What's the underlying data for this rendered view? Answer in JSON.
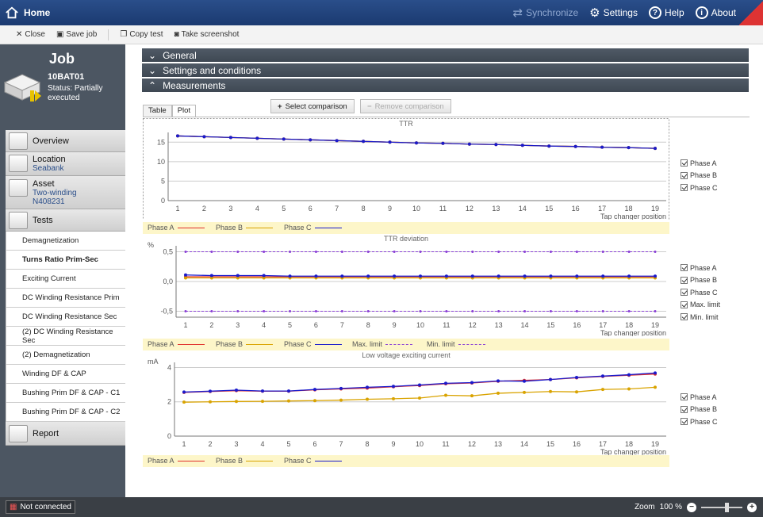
{
  "header": {
    "home": "Home",
    "synchronize": "Synchronize",
    "settings": "Settings",
    "help": "Help",
    "about": "About"
  },
  "toolbar": {
    "close": "Close",
    "save_job": "Save job",
    "copy_test": "Copy test",
    "take_screenshot": "Take screenshot"
  },
  "job": {
    "title": "Job",
    "id": "10BAT01",
    "status": "Status: Partially executed"
  },
  "nav": {
    "overview": "Overview",
    "location": "Location",
    "location_value": "Seabank",
    "asset": "Asset",
    "asset_type": "Two-winding",
    "asset_id": "N408231",
    "tests": "Tests",
    "report": "Report",
    "test_items": [
      "Demagnetization",
      "Turns Ratio Prim-Sec",
      "Exciting Current",
      "DC Winding Resistance Prim",
      "DC Winding Resistance Sec",
      "(2) DC Winding Resistance Sec",
      "(2) Demagnetization",
      "Winding DF & CAP",
      "Bushing Prim DF & CAP - C1",
      "Bushing Prim DF & CAP - C2"
    ],
    "active_test_index": 1
  },
  "sections": {
    "general": "General",
    "settings": "Settings and conditions",
    "measurements": "Measurements"
  },
  "tabs": {
    "table": "Table",
    "plot": "Plot"
  },
  "buttons": {
    "select_comparison": "Select comparison",
    "remove_comparison": "Remove comparison"
  },
  "status": {
    "connection": "Not connected",
    "zoom_label": "Zoom",
    "zoom_value": "100 %"
  },
  "colors": {
    "phase_a": "#e0302c",
    "phase_b": "#d9a300",
    "phase_c": "#1a1acc",
    "limit": "#8a3fd6"
  },
  "chart_data": [
    {
      "type": "line",
      "title": "TTR",
      "xlabel": "Tap changer position",
      "ylabel": "",
      "x": [
        1,
        2,
        3,
        4,
        5,
        6,
        7,
        8,
        9,
        10,
        11,
        12,
        13,
        14,
        15,
        16,
        17,
        18,
        19
      ],
      "ylim": [
        0,
        17.5
      ],
      "yticks": [
        0,
        5,
        10,
        15
      ],
      "series": [
        {
          "name": "Phase A",
          "values": [
            16.6,
            16.4,
            16.2,
            16.0,
            15.8,
            15.6,
            15.4,
            15.2,
            15.0,
            14.8,
            14.7,
            14.5,
            14.4,
            14.2,
            14.0,
            13.9,
            13.7,
            13.6,
            13.4
          ]
        },
        {
          "name": "Phase B",
          "values": [
            16.6,
            16.4,
            16.2,
            16.0,
            15.8,
            15.6,
            15.4,
            15.2,
            15.0,
            14.8,
            14.7,
            14.5,
            14.4,
            14.2,
            14.0,
            13.9,
            13.7,
            13.6,
            13.4
          ]
        },
        {
          "name": "Phase C",
          "values": [
            16.6,
            16.4,
            16.2,
            16.0,
            15.8,
            15.6,
            15.4,
            15.2,
            15.0,
            14.8,
            14.7,
            14.5,
            14.4,
            14.2,
            14.0,
            13.9,
            13.7,
            13.6,
            13.4
          ]
        }
      ],
      "legend_checks": [
        "Phase A",
        "Phase B",
        "Phase C"
      ]
    },
    {
      "type": "line",
      "title": "TTR deviation",
      "xlabel": "Tap changer position",
      "ylabel": "%",
      "x": [
        1,
        2,
        3,
        4,
        5,
        6,
        7,
        8,
        9,
        10,
        11,
        12,
        13,
        14,
        15,
        16,
        17,
        18,
        19
      ],
      "ylim": [
        -0.6,
        0.6
      ],
      "yticks": [
        -0.5,
        0.0,
        0.5
      ],
      "ytick_labels": [
        "-0,5",
        "0,0",
        "0,5"
      ],
      "series": [
        {
          "name": "Phase A",
          "values": [
            0.08,
            0.08,
            0.08,
            0.08,
            0.08,
            0.08,
            0.08,
            0.08,
            0.08,
            0.08,
            0.08,
            0.08,
            0.08,
            0.08,
            0.08,
            0.08,
            0.08,
            0.08,
            0.08
          ]
        },
        {
          "name": "Phase B",
          "values": [
            0.06,
            0.06,
            0.06,
            0.06,
            0.06,
            0.06,
            0.06,
            0.06,
            0.06,
            0.06,
            0.06,
            0.06,
            0.06,
            0.06,
            0.06,
            0.06,
            0.06,
            0.06,
            0.06
          ]
        },
        {
          "name": "Phase C",
          "values": [
            0.11,
            0.1,
            0.1,
            0.1,
            0.09,
            0.09,
            0.09,
            0.09,
            0.09,
            0.09,
            0.09,
            0.09,
            0.09,
            0.09,
            0.09,
            0.09,
            0.09,
            0.09,
            0.09
          ]
        },
        {
          "name": "Max. limit",
          "values": [
            0.5,
            0.5,
            0.5,
            0.5,
            0.5,
            0.5,
            0.5,
            0.5,
            0.5,
            0.5,
            0.5,
            0.5,
            0.5,
            0.5,
            0.5,
            0.5,
            0.5,
            0.5,
            0.5
          ]
        },
        {
          "name": "Min. limit",
          "values": [
            -0.5,
            -0.5,
            -0.5,
            -0.5,
            -0.5,
            -0.5,
            -0.5,
            -0.5,
            -0.5,
            -0.5,
            -0.5,
            -0.5,
            -0.5,
            -0.5,
            -0.5,
            -0.5,
            -0.5,
            -0.5,
            -0.5
          ]
        }
      ],
      "legend_checks": [
        "Phase A",
        "Phase B",
        "Phase C",
        "Max. limit",
        "Min. limit"
      ]
    },
    {
      "type": "line",
      "title": "Low voltage exciting current",
      "xlabel": "Tap changer position",
      "ylabel": "mA",
      "x": [
        1,
        2,
        3,
        4,
        5,
        6,
        7,
        8,
        9,
        10,
        11,
        12,
        13,
        14,
        15,
        16,
        17,
        18,
        19
      ],
      "ylim": [
        0,
        4.3
      ],
      "yticks": [
        0,
        2,
        4
      ],
      "series": [
        {
          "name": "Phase A",
          "values": [
            2.55,
            2.6,
            2.65,
            2.62,
            2.62,
            2.7,
            2.75,
            2.8,
            2.88,
            2.95,
            3.05,
            3.1,
            3.2,
            3.25,
            3.3,
            3.4,
            3.48,
            3.55,
            3.62
          ]
        },
        {
          "name": "Phase B",
          "values": [
            1.98,
            2.0,
            2.02,
            2.03,
            2.05,
            2.07,
            2.1,
            2.15,
            2.18,
            2.22,
            2.38,
            2.35,
            2.5,
            2.55,
            2.6,
            2.58,
            2.72,
            2.75,
            2.85
          ]
        },
        {
          "name": "Phase C",
          "values": [
            2.57,
            2.62,
            2.68,
            2.63,
            2.63,
            2.72,
            2.78,
            2.85,
            2.9,
            2.98,
            3.08,
            3.12,
            3.22,
            3.2,
            3.3,
            3.42,
            3.5,
            3.58,
            3.68
          ]
        }
      ],
      "legend_checks": [
        "Phase A",
        "Phase B",
        "Phase C"
      ]
    }
  ]
}
